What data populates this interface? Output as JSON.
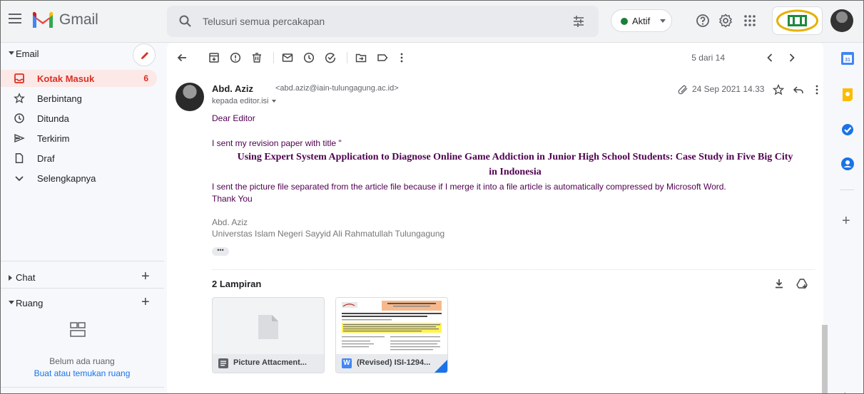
{
  "app": {
    "name": "Gmail",
    "colors": {
      "accent_red": "#d93025",
      "link_blue": "#1a73e8",
      "body_purple": "#500050",
      "status_green": "#188038"
    }
  },
  "topbar": {
    "search_placeholder": "Telusuri semua percakapan",
    "status_label": "Aktif",
    "icons": [
      "menu-icon",
      "search-icon",
      "filter-options-icon",
      "help-icon",
      "settings-icon",
      "apps-grid-icon"
    ]
  },
  "sidebar": {
    "email_section": "Email",
    "items": [
      {
        "label": "Kotak Masuk",
        "count": "6",
        "icon": "inbox-icon",
        "active": true
      },
      {
        "label": "Berbintang",
        "count": "",
        "icon": "star-icon",
        "active": false
      },
      {
        "label": "Ditunda",
        "count": "",
        "icon": "clock-icon",
        "active": false
      },
      {
        "label": "Terkirim",
        "count": "",
        "icon": "send-icon",
        "active": false
      },
      {
        "label": "Draf",
        "count": "",
        "icon": "draft-icon",
        "active": false
      },
      {
        "label": "Selengkapnya",
        "count": "",
        "icon": "chevron-down-icon",
        "active": false
      }
    ],
    "chat_section": "Chat",
    "rooms_section": "Ruang",
    "rooms_empty_text": "Belum ada ruang",
    "rooms_link": "Buat atau temukan ruang"
  },
  "toolbar": {
    "pager": "5 dari 14"
  },
  "message": {
    "sender_name": "Abd. Aziz",
    "sender_email": "<abd.aziz@iain-tulungagung.ac.id>",
    "recipient": "kepada editor.isi",
    "date": "24 Sep 2021 14.33",
    "greeting": "Dear Editor",
    "line1": "I sent my revision paper with title \"",
    "title_line1": "Using Expert System Application to Diagnose Online Game Addiction in Junior High School Students: Case Study in Five Big City",
    "title_line2": "in Indonesia",
    "line2": "I sent the picture file separated from the article file because if I merge it into a file article is automatically compressed by Microsoft Word.",
    "thanks": "Thank You",
    "signature_name": "Abd. Aziz",
    "signature_org": "Universtas Islam Negeri Sayyid Ali Rahmatullah Tulungagung",
    "ellipsis": "•••"
  },
  "attachments": {
    "title": "2 Lampiran",
    "files": [
      {
        "name": "Picture Attacment...",
        "badge": "",
        "badge_color": "#5f6368"
      },
      {
        "name": "(Revised) ISI-1294...",
        "badge": "W",
        "badge_color": "#4285f4"
      }
    ]
  }
}
